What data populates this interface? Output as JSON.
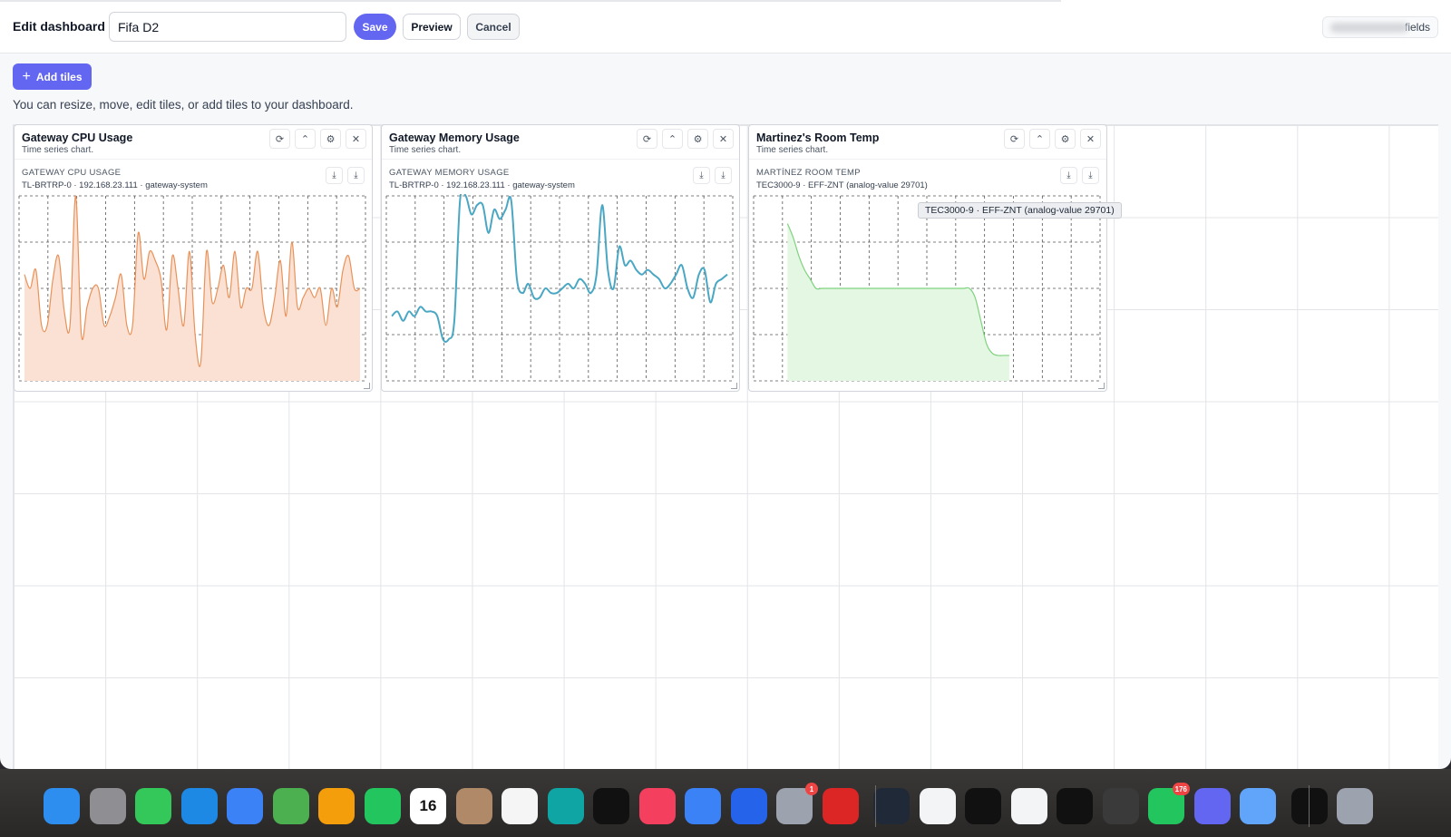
{
  "header": {
    "title": "Edit dashboard",
    "dashboard_name": "Fifa D2",
    "save_label": "Save",
    "preview_label": "Preview",
    "cancel_label": "Cancel",
    "fields_label": "fields"
  },
  "toolbar": {
    "add_tiles_label": "Add tiles",
    "hint": "You can resize, move, edit tiles, or add tiles to your dashboard."
  },
  "tiles": [
    {
      "title": "Gateway CPU Usage",
      "subtitle": "Time series chart.",
      "chart_title": "GATEWAY CPU USAGE",
      "chart_meta": "TL-BRTRP-0 · 192.168.23.111 · gateway-system"
    },
    {
      "title": "Gateway Memory Usage",
      "subtitle": "Time series chart.",
      "chart_title": "GATEWAY MEMORY USAGE",
      "chart_meta": "TL-BRTRP-0 · 192.168.23.111 · gateway-system"
    },
    {
      "title": "Martinez's Room Temp",
      "subtitle": "Time series chart.",
      "chart_title": "MARTÍNEZ ROOM TEMP",
      "chart_meta": "TEC3000-9 · EFF-ZNT (analog-value 29701)"
    }
  ],
  "tooltip": "TEC3000-9 · EFF-ZNT (analog-value 29701)",
  "chart_data": [
    {
      "type": "area",
      "title": "GATEWAY CPU USAGE",
      "color": "#e8925a",
      "fill": "#fbe1d3",
      "ylim": [
        0,
        4
      ],
      "grid": true,
      "series": [
        {
          "values": [
            2.3,
            2.0,
            2.4,
            1.2,
            1.2,
            2.2,
            2.7,
            1.5,
            1.2,
            4.0,
            1.0,
            1.6,
            2.0,
            2.0,
            1.2,
            1.4,
            1.8,
            2.3,
            1.2,
            1.2,
            3.2,
            2.2,
            2.8,
            2.6,
            2.2,
            1.1,
            2.7,
            2.0,
            1.2,
            2.8,
            1.0,
            0.4,
            2.8,
            1.7,
            2.0,
            2.5,
            1.8,
            2.8,
            1.6,
            2.0,
            2.0,
            2.8,
            1.6,
            1.2,
            1.8,
            2.6,
            1.4,
            3.0,
            1.6,
            1.8,
            2.0,
            1.8,
            2.0,
            1.2,
            2.0,
            1.6,
            2.4,
            2.7,
            2.0,
            2.0
          ]
        }
      ]
    },
    {
      "type": "line",
      "title": "GATEWAY MEMORY USAGE",
      "color": "#4aa7c4",
      "ylim": [
        0,
        4
      ],
      "grid": true,
      "series": [
        {
          "values": [
            1.4,
            1.5,
            1.3,
            1.5,
            1.4,
            1.6,
            1.5,
            1.5,
            1.4,
            0.9,
            0.9,
            1.3,
            3.9,
            4.0,
            3.6,
            3.8,
            3.8,
            3.2,
            3.7,
            3.5,
            3.7,
            3.9,
            2.2,
            1.9,
            2.1,
            1.8,
            1.8,
            2.0,
            1.9,
            1.9,
            2.0,
            2.1,
            2.0,
            2.2,
            2.1,
            1.9,
            2.3,
            3.8,
            2.4,
            2.0,
            2.9,
            2.5,
            2.6,
            2.4,
            2.3,
            2.4,
            2.3,
            2.2,
            2.0,
            2.1,
            2.3,
            2.5,
            2.0,
            1.8,
            2.3,
            2.4,
            1.7,
            2.1,
            2.2,
            2.3
          ]
        }
      ]
    },
    {
      "type": "area",
      "title": "MARTÍNEZ ROOM TEMP",
      "color": "#7fd27f",
      "fill": "#e3f7e3",
      "ylim": [
        0,
        4
      ],
      "grid": true,
      "series": [
        {
          "values": [
            null,
            null,
            null,
            null,
            null,
            3.4,
            3.1,
            2.7,
            2.4,
            2.2,
            2.0,
            2.0,
            2.0,
            2.0,
            2.0,
            2.0,
            2.0,
            2.0,
            2.0,
            2.0,
            2.0,
            2.0,
            2.0,
            2.0,
            2.0,
            2.0,
            2.0,
            2.0,
            2.0,
            2.0,
            2.0,
            2.0,
            2.0,
            2.0,
            2.0,
            2.0,
            2.0,
            2.0,
            1.8,
            1.3,
            0.8,
            0.6,
            0.55,
            0.55,
            0.55,
            null,
            null,
            null,
            null,
            null,
            null,
            null,
            null,
            null,
            null,
            null,
            null,
            null,
            null,
            null
          ]
        }
      ]
    }
  ],
  "dock": [
    {
      "icon": "finder-icon",
      "color": "#2d8ef0"
    },
    {
      "icon": "launchpad-icon",
      "color": "#8e8e93"
    },
    {
      "icon": "messages-icon",
      "color": "#34c759"
    },
    {
      "icon": "safari-icon",
      "color": "#1e88e5"
    },
    {
      "icon": "mail-icon",
      "color": "#3b82f6"
    },
    {
      "icon": "maps-icon",
      "color": "#4caf50"
    },
    {
      "icon": "photos-icon",
      "color": "#f59e0b"
    },
    {
      "icon": "facetime-icon",
      "color": "#22c55e"
    },
    {
      "icon": "calendar-icon",
      "color": "#ffffff",
      "text": "16"
    },
    {
      "icon": "contacts-icon",
      "color": "#b08968"
    },
    {
      "icon": "reminders-icon",
      "color": "#f5f5f5"
    },
    {
      "icon": "freeform-icon",
      "color": "#0ea5a4"
    },
    {
      "icon": "tv-icon",
      "color": "#111111"
    },
    {
      "icon": "music-icon",
      "color": "#f43f5e"
    },
    {
      "icon": "keynote-icon",
      "color": "#3b82f6"
    },
    {
      "icon": "app-store-icon",
      "color": "#2563eb"
    },
    {
      "icon": "system-settings-icon",
      "color": "#9ca3af",
      "badge": "1"
    },
    {
      "icon": "acrobat-icon",
      "color": "#dc2626"
    },
    {
      "icon": "arc-icon",
      "color": "#1f2937"
    },
    {
      "icon": "xcode-instruments-icon",
      "color": "#f3f4f6"
    },
    {
      "icon": "terminal-icon",
      "color": "#111111"
    },
    {
      "icon": "chrome-icon",
      "color": "#f3f4f6"
    },
    {
      "icon": "app-icon",
      "color": "#111111"
    },
    {
      "icon": "sublime-icon",
      "color": "#3a3a3a"
    },
    {
      "icon": "whatsapp-icon",
      "color": "#22c55e",
      "badge": "176"
    },
    {
      "icon": "teams-icon",
      "color": "#6366f1"
    },
    {
      "icon": "finder-window-icon",
      "color": "#60a5fa"
    },
    {
      "icon": "phone-mirror-icon",
      "color": "#111111"
    },
    {
      "icon": "trash-icon",
      "color": "#9ca3af"
    }
  ]
}
